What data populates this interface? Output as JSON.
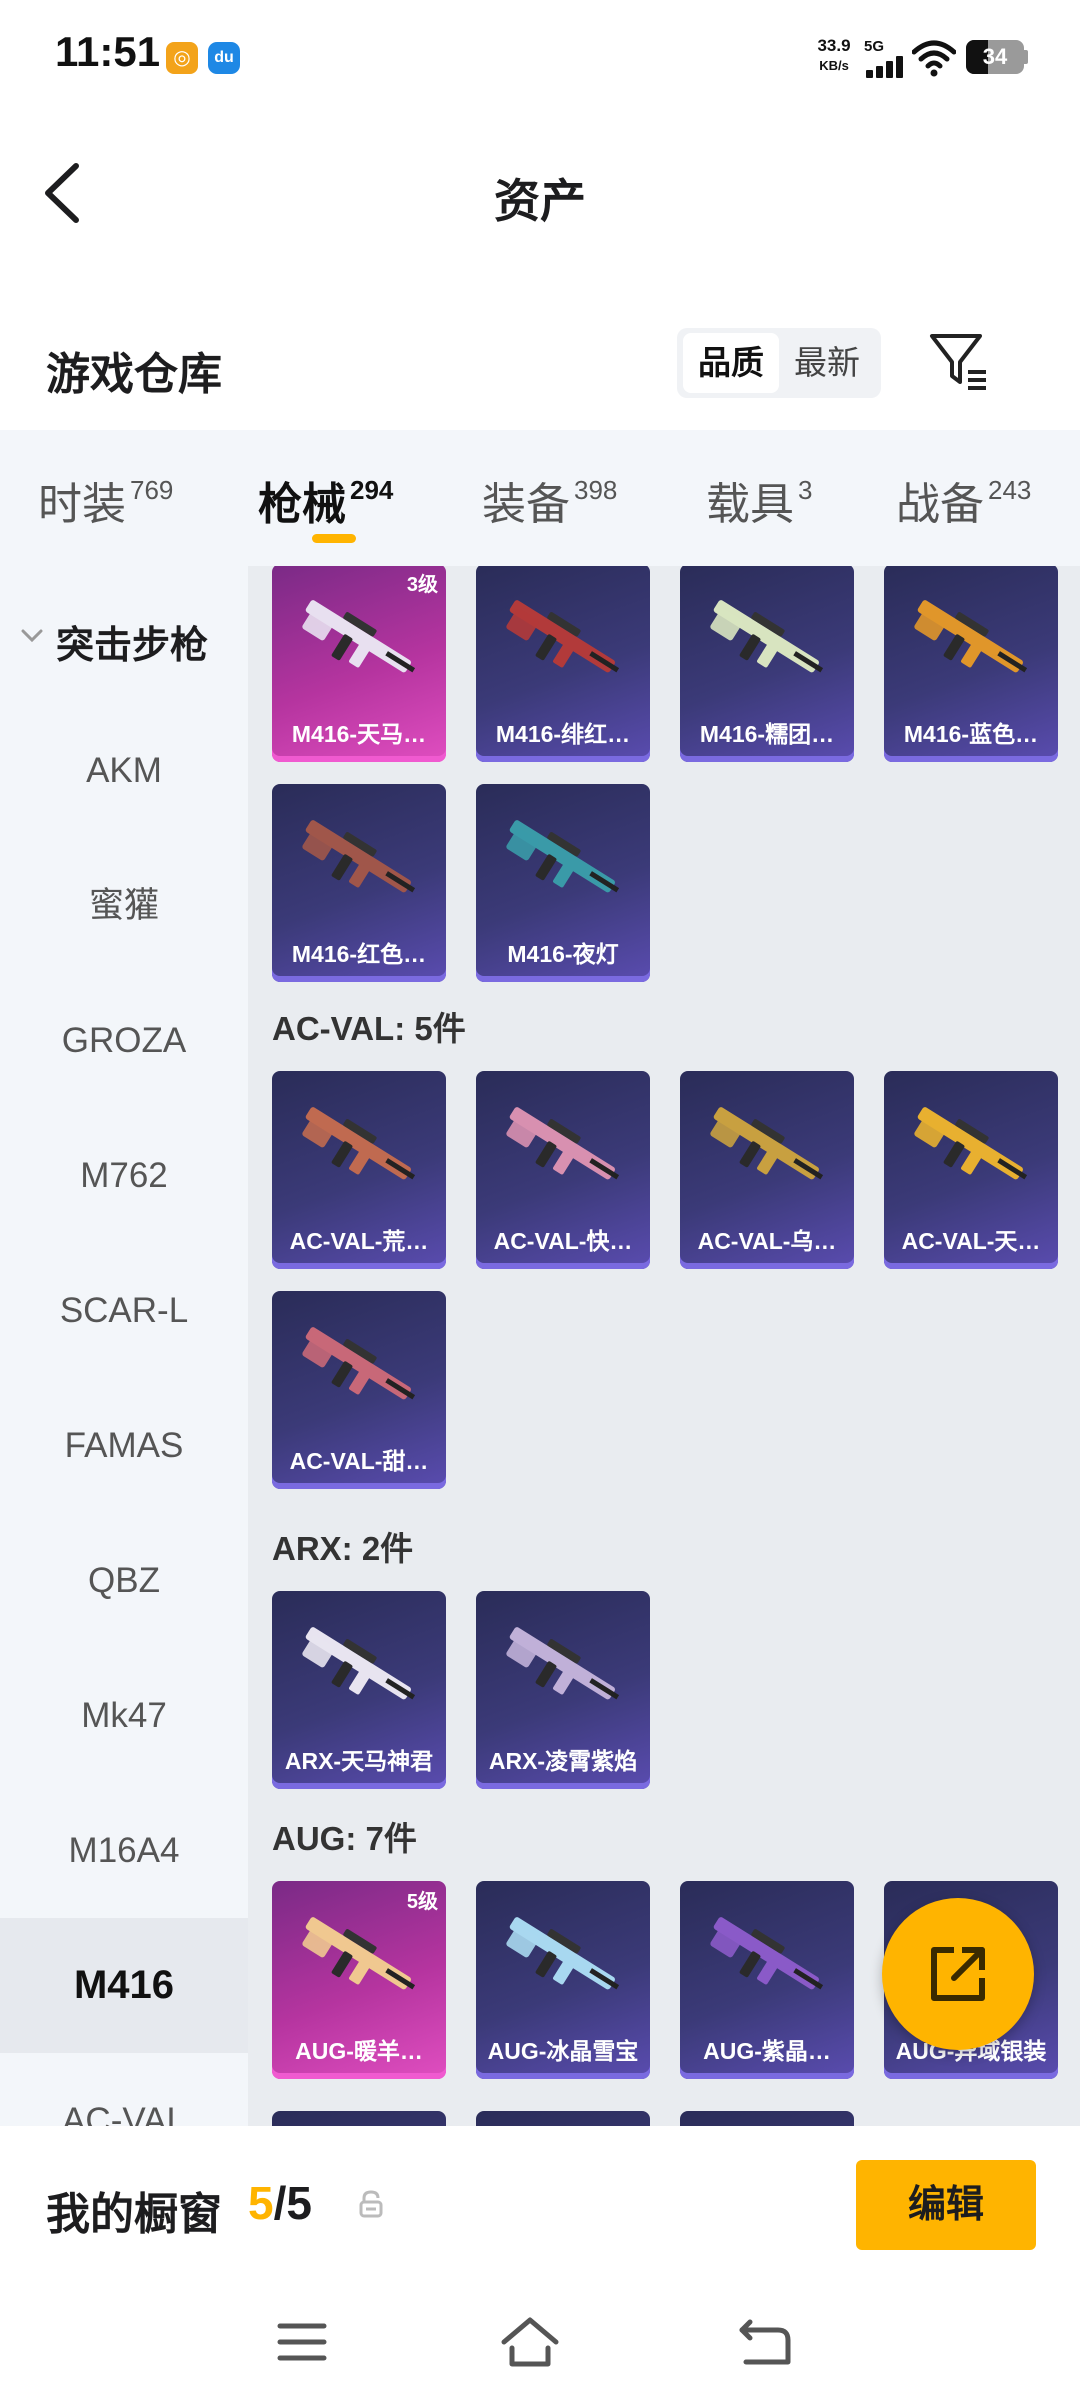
{
  "status_bar": {
    "time": "11:51",
    "app_icon_1": "app-badge-icon",
    "app_icon_2": "du",
    "net_speed": "33.9",
    "net_unit": "KB/s",
    "network": "5G",
    "battery": "34"
  },
  "header": {
    "title": "资产"
  },
  "warehouse": {
    "title": "游戏仓库",
    "sort_options": [
      "品质",
      "最新"
    ],
    "sort_selected": "品质"
  },
  "tabs": [
    {
      "label": "时装",
      "count": "769"
    },
    {
      "label": "枪械",
      "count": "294"
    },
    {
      "label": "装备",
      "count": "398"
    },
    {
      "label": "载具",
      "count": "3"
    },
    {
      "label": "战备",
      "count": "243"
    }
  ],
  "sidebar": {
    "group": "突击步枪",
    "items": [
      "AKM",
      "蜜獾",
      "GROZA",
      "M762",
      "SCAR-L",
      "FAMAS",
      "QBZ",
      "Mk47",
      "M16A4",
      "M416",
      "AC-VAL"
    ],
    "active": "M416"
  },
  "sections": [
    {
      "title": "",
      "items": [
        {
          "name": "M416-天马…",
          "level": "3级",
          "rarity": "legend",
          "gun_color": "#e8e0f0"
        },
        {
          "name": "M416-绯红…",
          "level": "",
          "rarity": "epic",
          "gun_color": "#b23a3a"
        },
        {
          "name": "M416-糯团…",
          "level": "",
          "rarity": "epic",
          "gun_color": "#d8e4c0"
        },
        {
          "name": "M416-蓝色…",
          "level": "",
          "rarity": "epic",
          "gun_color": "#e0962a"
        },
        {
          "name": "M416-红色…",
          "level": "",
          "rarity": "epic",
          "gun_color": "#a0564a"
        },
        {
          "name": "M416-夜灯",
          "level": "",
          "rarity": "epic",
          "gun_color": "#3a9aa8"
        }
      ]
    },
    {
      "title": "AC-VAL: 5件",
      "items": [
        {
          "name": "AC-VAL-荒…",
          "level": "",
          "rarity": "epic",
          "gun_color": "#c06a50"
        },
        {
          "name": "AC-VAL-快…",
          "level": "",
          "rarity": "epic",
          "gun_color": "#d890b0"
        },
        {
          "name": "AC-VAL-乌…",
          "level": "",
          "rarity": "epic",
          "gun_color": "#c8a040"
        },
        {
          "name": "AC-VAL-天…",
          "level": "",
          "rarity": "epic",
          "gun_color": "#e8b030"
        },
        {
          "name": "AC-VAL-甜…",
          "level": "",
          "rarity": "epic",
          "gun_color": "#c86878"
        }
      ]
    },
    {
      "title": "ARX: 2件",
      "items": [
        {
          "name": "ARX-天马神君",
          "level": "",
          "rarity": "epic",
          "gun_color": "#e8e4f0"
        },
        {
          "name": "ARX-凌霄紫焰",
          "level": "",
          "rarity": "epic",
          "gun_color": "#c0b0d8"
        }
      ]
    },
    {
      "title": "AUG: 7件",
      "items": [
        {
          "name": "AUG-暖羊…",
          "level": "5级",
          "rarity": "legend",
          "gun_color": "#f0c890"
        },
        {
          "name": "AUG-冰晶雪宝",
          "level": "",
          "rarity": "epic",
          "gun_color": "#a8d8f0"
        },
        {
          "name": "AUG-紫晶…",
          "level": "",
          "rarity": "epic",
          "gun_color": "#8a5ac8"
        },
        {
          "name": "AUG-异域银装",
          "level": "",
          "rarity": "epic",
          "gun_color": "#c0c8d8"
        }
      ]
    }
  ],
  "bottom": {
    "showcase_label": "我的橱窗",
    "showcase_used": "5",
    "showcase_sep": "/",
    "showcase_total": "5",
    "edit_label": "编辑"
  },
  "icons": {
    "back": "back-arrow-icon",
    "filter": "filter-icon",
    "share": "share-icon",
    "lock": "lock-icon",
    "nav": [
      "menu-icon",
      "home-icon",
      "back-icon"
    ]
  },
  "colors": {
    "accent": "#ffb400",
    "legend": "#d23fb4",
    "epic": "#3b3a78"
  }
}
